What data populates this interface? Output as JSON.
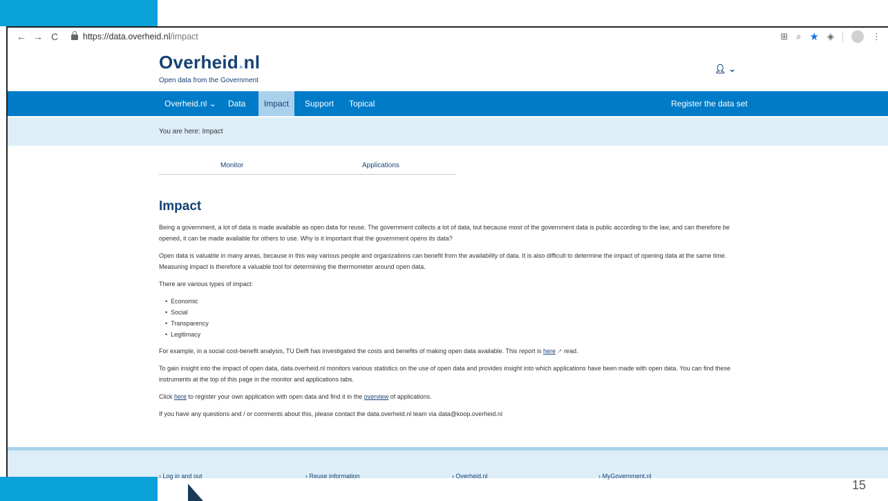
{
  "browser": {
    "back_glyph": "←",
    "forward_glyph": "→",
    "reload_glyph": "C",
    "url_host": "https://data.overheid.nl",
    "url_path": "/impact"
  },
  "header": {
    "logo_main": "Overheid",
    "logo_dot": ".",
    "logo_tld": "nl",
    "tagline": "Open data from the Government"
  },
  "nav": {
    "items": [
      {
        "label": "Overheid.nl ⌄"
      },
      {
        "label": "Data"
      },
      {
        "label": "Impact"
      },
      {
        "label": "Support"
      },
      {
        "label": "Topical"
      }
    ],
    "register": "Register the data set"
  },
  "breadcrumb": {
    "prefix": "You are here:",
    "current": "Impact"
  },
  "subtabs": [
    "Monitor",
    "Applications"
  ],
  "main": {
    "title": "Impact",
    "p1": "Being a government, a lot of data is made available as open data for reuse. The government collects a lot of data, but because most of the government data is public according to the law, and can therefore be opened, it can be made available for others to use. Why is it important that the government opens its data?",
    "p2": "Open data is valuable in many areas, because in this way various people and organizations can benefit from the availability of data. It is also difficult to determine the impact of opening data at the same time. Measuring impact is therefore a valuable tool for determining the thermometer around open data.",
    "p3": "There are various types of impact:",
    "impacts": [
      "Economic",
      "Social",
      "Transparency",
      "Legitimacy"
    ],
    "p4_before": "For example, in a social cost-benefit analysis, TU Delft has investigated the costs and benefits of making open data available. This report is",
    "p4_link": "here",
    "p4_after": "read.",
    "p5": "To gain insight into the impact of open data, data.overheid.nl monitors various statistics on the use of open data and provides insight into which applications have been made with open data. You can find these instruments at the top of this page in the monitor and applications tabs.",
    "p6_a": "Click",
    "p6_link1": "here",
    "p6_b": "to register your own application with open data and find it in the",
    "p6_link2": "overview",
    "p6_c": "of applications.",
    "p7": "If you have any questions and / or comments about this, please contact the data.overheid.nl team via data@koop.overheid.nl"
  },
  "footer": {
    "links": [
      "› Log in and out",
      "› Reuse information",
      "› Overheid.nl",
      "› MyGovernment.nl"
    ]
  },
  "slide": {
    "page_number": "15"
  },
  "colors": {
    "brand": "#154273",
    "nav": "#007bc7",
    "nav_active": "#a9d1ec",
    "crumb_bg": "#ddeef8",
    "slide_accent": "#0aa0d8"
  }
}
